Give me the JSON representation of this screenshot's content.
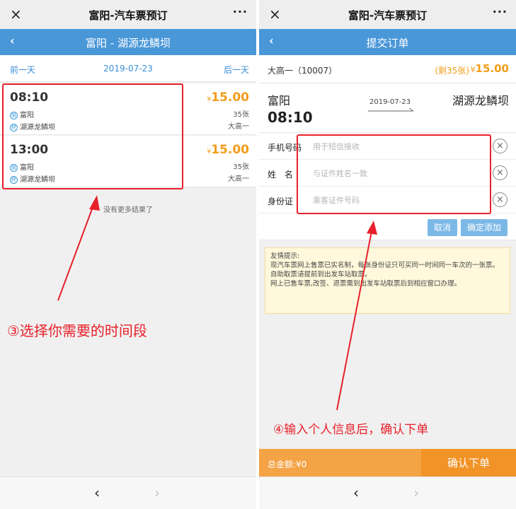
{
  "left": {
    "topbar": {
      "close_icon": "×",
      "title": "富阳-汽车票预订",
      "more_icon": "···"
    },
    "nav": {
      "back_icon": "‹",
      "title": "富阳 - 湖源龙鳞坝"
    },
    "day_nav": {
      "prev": "前一天",
      "date": "2019-07-23",
      "next": "后一天"
    },
    "trips": [
      {
        "time": "08:10",
        "from_badge": "始",
        "from": "富阳",
        "to_badge": "终",
        "to": "湖源龙鳞坝",
        "currency": "¥",
        "price": "15.00",
        "remaining": "35张",
        "operator": "大高一"
      },
      {
        "time": "13:00",
        "from_badge": "始",
        "from": "富阳",
        "to_badge": "终",
        "to": "湖源龙鳞坝",
        "currency": "¥",
        "price": "15.00",
        "remaining": "35张",
        "operator": "大高一"
      }
    ],
    "no_more": "没有更多结果了",
    "annotation": "③选择你需要的时间段",
    "bottom": {
      "prev_icon": "‹",
      "next_icon": "›"
    }
  },
  "right": {
    "topbar": {
      "close_icon": "×",
      "title": "富阳-汽车票预订",
      "more_icon": "···"
    },
    "nav": {
      "back_icon": "‹",
      "title": "提交订单"
    },
    "schedule": {
      "bus": "大高一（10007）",
      "remaining": "(剩35张)",
      "currency": "¥",
      "price": "15.00"
    },
    "route": {
      "from": "富阳",
      "time": "08:10",
      "date": "2019-07-23",
      "to": "湖源龙鳞坝"
    },
    "form": {
      "phone_label": "手机号码",
      "phone_placeholder": "用于短信接收",
      "phone_value": "",
      "name_label": "姓　名",
      "name_placeholder": "与证件姓名一致",
      "name_value": "",
      "id_label": "身份证",
      "id_placeholder": "乘客证件号码",
      "id_value": "",
      "clear_icon": "×",
      "cancel": "取消",
      "confirm_add": "确定添加"
    },
    "tips": {
      "title": "友情提示:",
      "line1": "现汽车票网上售票已实名制，每张身份证只可买同一时间同一车次的一张票。",
      "line2": "自助取票请提前到出发车站取票。",
      "line3": "网上已售车票,改签、退票需到出发车站取票后到相应窗口办理。"
    },
    "submit": {
      "total": "总金额:¥0",
      "confirm": "确认下单"
    },
    "annotation": "④输入个人信息后，确认下单",
    "bottom": {
      "prev_icon": "‹",
      "next_icon": "›"
    }
  },
  "colors": {
    "nav_blue": "#4a97d8",
    "price_orange": "#f29d19",
    "annotation_red": "#e8202a",
    "submit_orange": "#f29327"
  }
}
